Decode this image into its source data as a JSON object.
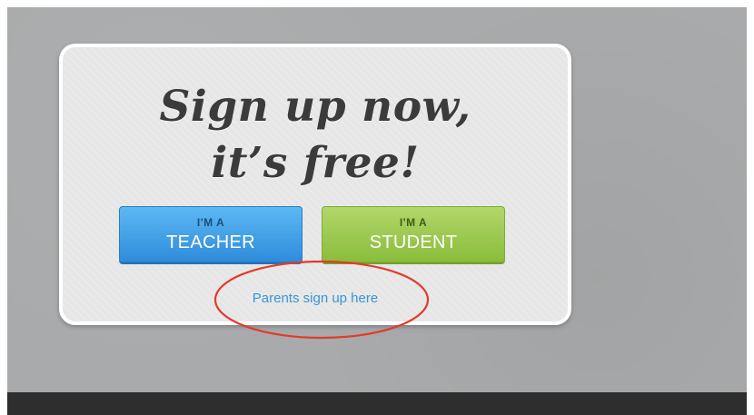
{
  "signup_card": {
    "headline_line1": "Sign up now,",
    "headline_line2": "it’s free!",
    "teacher_button": {
      "prefix": "I'M A",
      "label": "TEACHER",
      "color": "#3a9be6"
    },
    "student_button": {
      "prefix": "I'M A",
      "label": "STUDENT",
      "color": "#9cc94f"
    },
    "parents_link": "Parents sign up here"
  },
  "annotation": {
    "shape": "ellipse",
    "color": "#e23b2a"
  }
}
